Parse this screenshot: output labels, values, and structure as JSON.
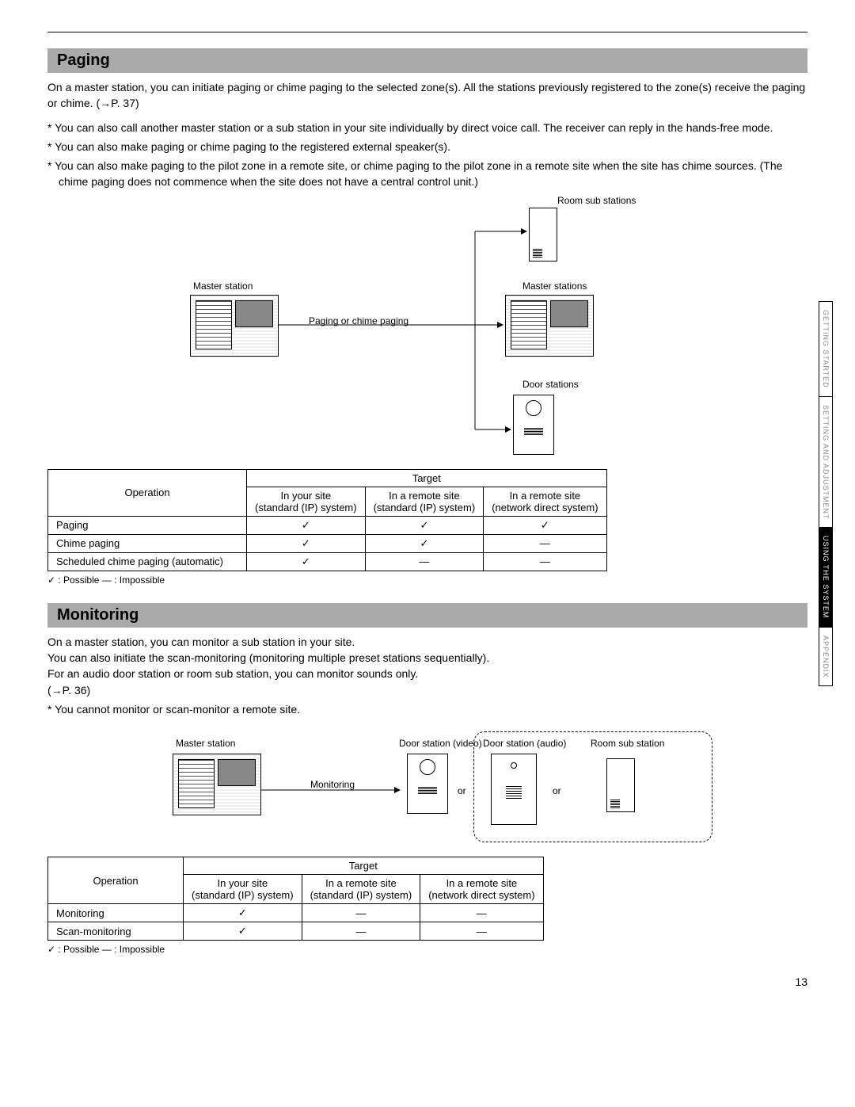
{
  "page_number": "13",
  "side_tabs": [
    "GETTING STARTED",
    "SETTING AND ADJUSTMENT",
    "USING THE SYSTEM",
    "APPENDIX"
  ],
  "active_side_tab_index": 2,
  "sections": {
    "paging": {
      "title": "Paging",
      "intro": "On a master station, you can initiate paging or chime paging to the selected zone(s). All the stations previously registered to the zone(s) receive the paging or chime. (→P. 37)",
      "notes": [
        "You can also call another master station or a sub station in your site individually by direct voice call. The receiver can reply in the hands-free mode.",
        "You can also make paging or chime paging to the registered external speaker(s).",
        "You can also make paging to the pilot zone in a remote site, or chime paging to the pilot zone in a remote site when the site has chime sources. (The chime paging does not commence when the site does not have a central control unit.)"
      ],
      "diagram_labels": {
        "master_station": "Master station",
        "paging_or_chime": "Paging or chime paging",
        "room_sub_stations": "Room sub stations",
        "master_stations": "Master stations",
        "door_stations": "Door stations"
      },
      "table": {
        "operation_header": "Operation",
        "target_header": "Target",
        "cols": [
          {
            "l1": "In your site",
            "l2": "(standard (IP) system)"
          },
          {
            "l1": "In a remote site",
            "l2": "(standard (IP) system)"
          },
          {
            "l1": "In a remote site",
            "l2": "(network direct system)"
          }
        ],
        "rows": [
          {
            "op": "Paging",
            "v": [
              "✓",
              "✓",
              "✓"
            ]
          },
          {
            "op": "Chime paging",
            "v": [
              "✓",
              "✓",
              "—"
            ]
          },
          {
            "op": "Scheduled chime paging (automatic)",
            "v": [
              "✓",
              "—",
              "—"
            ]
          }
        ]
      },
      "legend": "✓ : Possible    — : Impossible"
    },
    "monitoring": {
      "title": "Monitoring",
      "intro_lines": [
        "On a master station, you can monitor a sub station in your site.",
        "You can also initiate the scan-monitoring (monitoring multiple preset stations sequentially).",
        "For an audio door station or room sub station, you can monitor sounds only.",
        "(→P. 36)"
      ],
      "notes": [
        "You cannot monitor or scan-monitor a remote site."
      ],
      "diagram_labels": {
        "master_station": "Master station",
        "monitoring": "Monitoring",
        "door_video": "Door station (video)",
        "door_audio": "Door station (audio)",
        "room_sub": "Room sub station",
        "or": "or"
      },
      "table": {
        "operation_header": "Operation",
        "target_header": "Target",
        "cols": [
          {
            "l1": "In your site",
            "l2": "(standard (IP) system)"
          },
          {
            "l1": "In a remote site",
            "l2": "(standard (IP) system)"
          },
          {
            "l1": "In a remote site",
            "l2": "(network direct system)"
          }
        ],
        "rows": [
          {
            "op": "Monitoring",
            "v": [
              "✓",
              "—",
              "—"
            ]
          },
          {
            "op": "Scan-monitoring",
            "v": [
              "✓",
              "—",
              "—"
            ]
          }
        ]
      },
      "legend": "✓ : Possible    — : Impossible"
    }
  }
}
